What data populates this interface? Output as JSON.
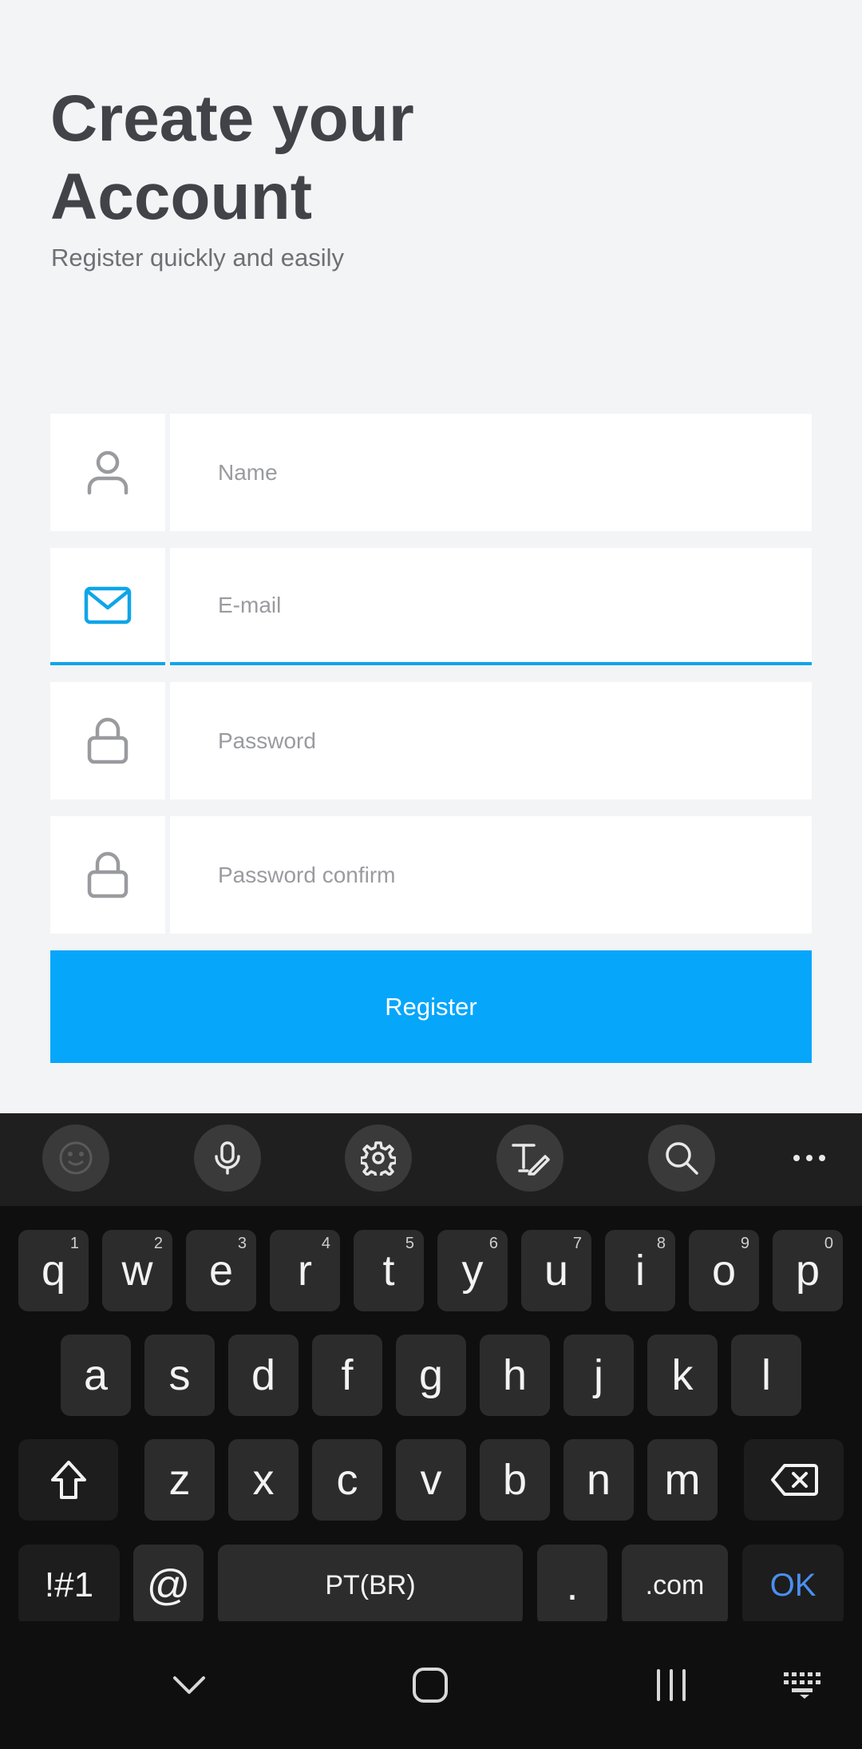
{
  "header": {
    "title": "Create your Account",
    "subtitle": "Register quickly and easily"
  },
  "form": {
    "name_placeholder": "Name",
    "email_placeholder": "E-mail",
    "password_placeholder": "Password",
    "password_confirm_placeholder": "Password confirm",
    "register_label": "Register",
    "focused_field": "email",
    "accent_color": "#06a6fb"
  },
  "keyboard": {
    "toolbar": [
      "emoji-icon",
      "microphone-icon",
      "settings-icon",
      "handwriting-icon",
      "search-icon",
      "more-icon"
    ],
    "row1": [
      {
        "k": "q",
        "n": "1"
      },
      {
        "k": "w",
        "n": "2"
      },
      {
        "k": "e",
        "n": "3"
      },
      {
        "k": "r",
        "n": "4"
      },
      {
        "k": "t",
        "n": "5"
      },
      {
        "k": "y",
        "n": "6"
      },
      {
        "k": "u",
        "n": "7"
      },
      {
        "k": "i",
        "n": "8"
      },
      {
        "k": "o",
        "n": "9"
      },
      {
        "k": "p",
        "n": "0"
      }
    ],
    "row2": [
      "a",
      "s",
      "d",
      "f",
      "g",
      "h",
      "j",
      "k",
      "l"
    ],
    "row3": [
      "z",
      "x",
      "c",
      "v",
      "b",
      "n",
      "m"
    ],
    "symbols_label": "!#1",
    "at_label": "@",
    "space_label": "PT(BR)",
    "period_label": ".",
    "dotcom_label": ".com",
    "ok_label": "OK"
  },
  "navbar": [
    "hide-keyboard-icon",
    "home-icon",
    "recents-icon",
    "keyboard-icon"
  ]
}
